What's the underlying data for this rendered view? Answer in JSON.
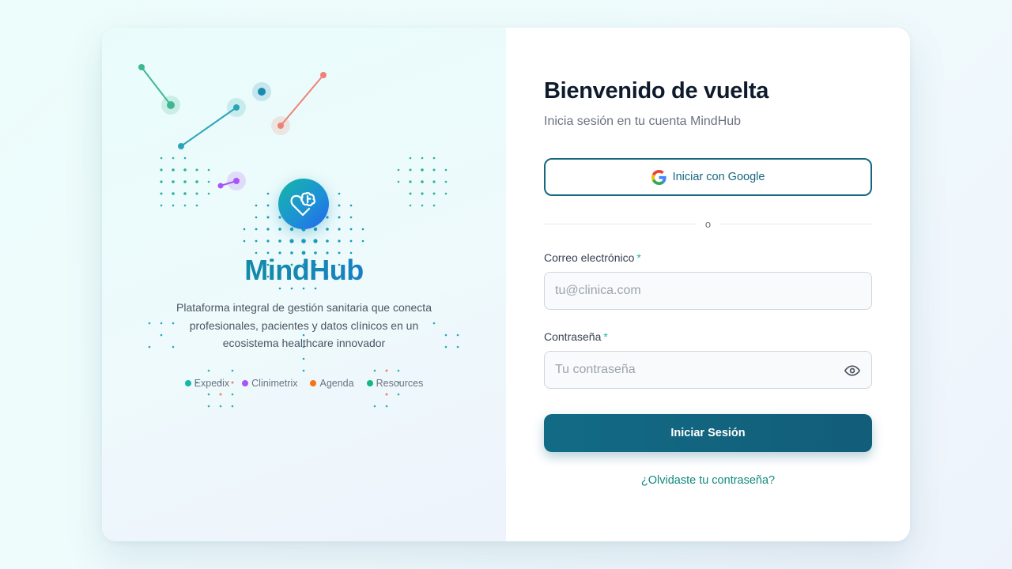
{
  "brand": {
    "name": "MindHub",
    "tagline": "Plataforma integral de gestión sanitaria que conecta profesionales, pacientes y datos clínicos en un ecosistema healthcare innovador",
    "modules": [
      {
        "label": "Expedix",
        "color": "#14b8a6"
      },
      {
        "label": "Clinimetrix",
        "color": "#a855f7"
      },
      {
        "label": "Agenda",
        "color": "#f97316"
      },
      {
        "label": "Resources",
        "color": "#10b981"
      }
    ]
  },
  "login": {
    "title": "Bienvenido de vuelta",
    "subtitle": "Inicia sesión en tu cuenta MindHub",
    "google_label": "Iniciar con Google",
    "divider": "o",
    "email_label": "Correo electrónico",
    "email_placeholder": "tu@clinica.com",
    "email_value": "",
    "password_label": "Contraseña",
    "password_placeholder": "Tu contraseña",
    "password_value": "",
    "required_mark": "*",
    "submit_label": "Iniciar Sesión",
    "forgot_label": "¿Olvidaste tu contraseña?"
  },
  "icons": {
    "logo": "brain-heart-icon",
    "google": "google-icon",
    "password_toggle": "eye-icon"
  },
  "colors": {
    "primary": "#126b85",
    "accent": "#14b8a6",
    "brand_gradient_start": "#0d9488",
    "brand_gradient_end": "#2563eb"
  }
}
